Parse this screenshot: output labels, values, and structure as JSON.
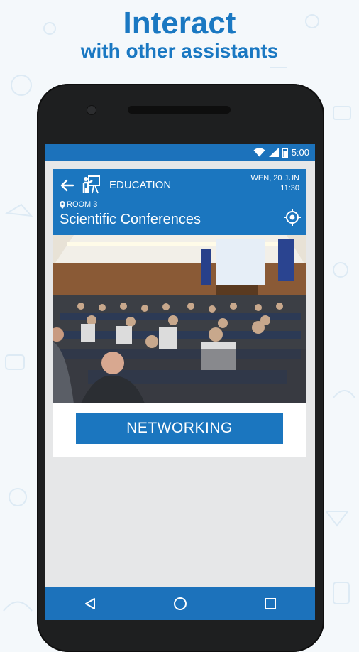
{
  "promo": {
    "headline": "Interact",
    "subheadline": "with other assistants"
  },
  "status_bar": {
    "time": "5:00",
    "icons": [
      "wifi-icon",
      "signal-icon",
      "battery-icon"
    ]
  },
  "app_bar": {
    "category": "EDUCATION",
    "date": "WEN, 20 JUN",
    "time": "11:30",
    "room": "ROOM 3",
    "title": "Scientific Conferences"
  },
  "action": {
    "networking_label": "NETWORKING"
  },
  "colors": {
    "primary": "#1b76bf",
    "status_nav": "#1c72bb",
    "headline": "#1a78c2",
    "background": "#e6e7e8"
  }
}
